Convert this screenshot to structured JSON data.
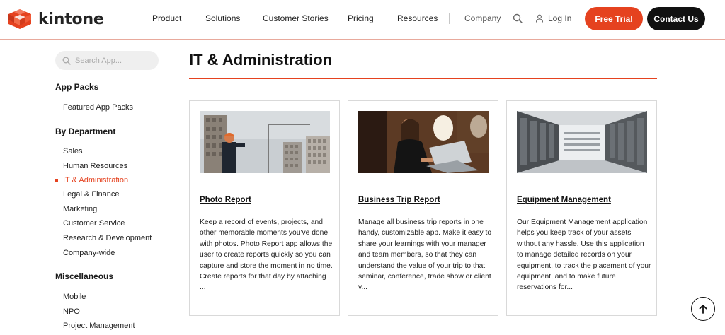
{
  "header": {
    "brand": "kintone",
    "nav": [
      "Product",
      "Solutions",
      "Customer Stories",
      "Pricing",
      "Resources",
      "Company"
    ],
    "login": "Log In",
    "free_trial": "Free Trial",
    "contact": "Contact Us",
    "accent_color": "#e5421f"
  },
  "sidebar": {
    "search_placeholder": "Search App...",
    "app_packs_heading": "App Packs",
    "app_packs": [
      "Featured App Packs"
    ],
    "department_heading": "By Department",
    "departments": [
      "Sales",
      "Human Resources",
      "IT & Administration",
      "Legal & Finance",
      "Marketing",
      "Customer Service",
      "Research & Development",
      "Company-wide"
    ],
    "active_department": "IT & Administration",
    "misc_heading": "Miscellaneous",
    "misc": [
      "Mobile",
      "NPO",
      "Project Management"
    ]
  },
  "main": {
    "title": "IT & Administration",
    "cards": [
      {
        "title": "Photo Report",
        "image": "construction-worker-photo",
        "description": "Keep a record of events, projects, and other memorable moments you've done with photos. Photo Report app allows the user to create reports quickly so you can capture and store the moment in no time. Create reports for that day by attaching ..."
      },
      {
        "title": "Business Trip Report",
        "image": "woman-on-plane-laptop-photo",
        "description": "Manage all business trip reports in one handy, customizable app. Make it easy to share your learnings with your manager and team members, so that they can understand the value of your trip to that seminar, conference, trade show or client v..."
      },
      {
        "title": "Equipment Management",
        "image": "server-room-photo",
        "description": "Our Equipment Management application helps you keep track of your assets without any hassle. Use this application to manage detailed records on your equipment, to track the placement of your equipment, and to make future reservations for..."
      }
    ]
  },
  "icons": {
    "search": "search-icon",
    "user": "user-icon",
    "scroll_top": "arrow-up-icon"
  }
}
